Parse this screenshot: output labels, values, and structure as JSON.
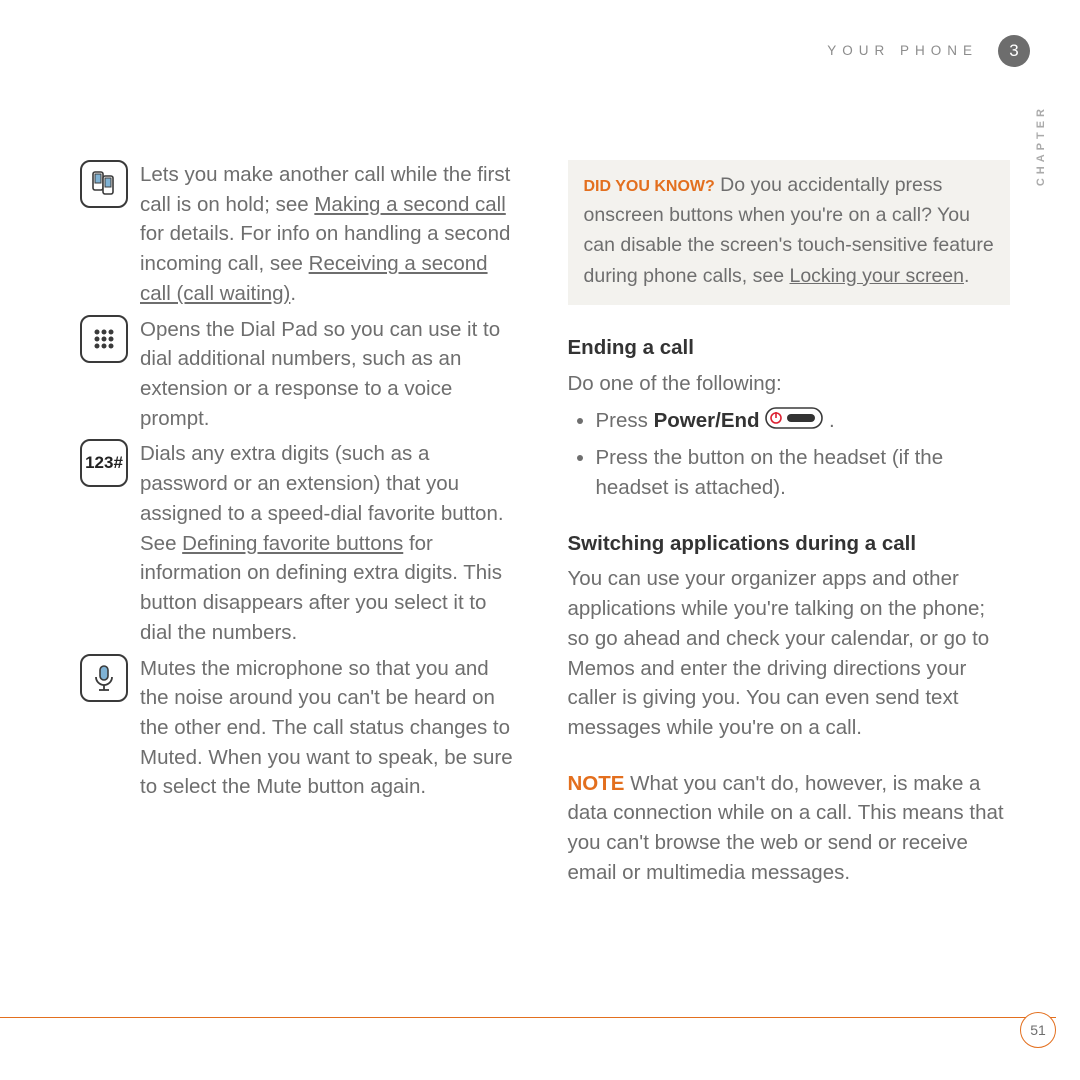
{
  "header": {
    "section": "YOUR PHONE",
    "chapter_number": "3",
    "side_label": "CHAPTER"
  },
  "left": {
    "items": [
      {
        "text_pre": "Lets you make another call while the first call is on hold; see ",
        "link1": "Making a second call",
        "text_mid": " for details. For info on handling a second incoming call, see ",
        "link2": "Receiving a second call (call waiting)",
        "text_post": "."
      },
      {
        "text": "Opens the Dial Pad so you can use it to dial additional numbers, such as an extension or a response to a voice prompt."
      },
      {
        "label": "123#",
        "text_pre": "Dials any extra digits (such as a password or an extension) that you assigned to a speed-dial favorite button. See ",
        "link1": "Defining favorite buttons",
        "text_post": " for information on defining extra digits. This button disappears after you select it to dial the numbers."
      },
      {
        "text": "Mutes the microphone so that you and the noise around you can't be heard on the other end. The call status changes to Muted. When you want to speak, be sure to select the Mute button again."
      }
    ]
  },
  "right": {
    "callout": {
      "label": "DID YOU KNOW?",
      "text_pre": " Do you accidentally press onscreen buttons when you're on a call? You can disable the screen's touch-sensitive feature during phone calls, see ",
      "link": "Locking your screen",
      "text_post": "."
    },
    "section1": {
      "title": "Ending a call",
      "intro": "Do one of the following:",
      "bullets": [
        {
          "pre": "Press ",
          "strong": "Power/End",
          "post": " ."
        },
        {
          "text": "Press the button on the headset (if the headset is attached)."
        }
      ]
    },
    "section2": {
      "title": "Switching applications during a call",
      "para": "You can use your organizer apps and other applications while you're talking on the phone; so go ahead and check your calendar, or go to Memos and enter the driving directions your caller is giving you. You can even send text messages while you're on a call."
    },
    "note": {
      "label": "NOTE",
      "text": " What you can't do, however, is make a data connection while on a call. This means that you can't browse the web or send or receive email or multimedia messages."
    }
  },
  "footer": {
    "page": "51"
  }
}
